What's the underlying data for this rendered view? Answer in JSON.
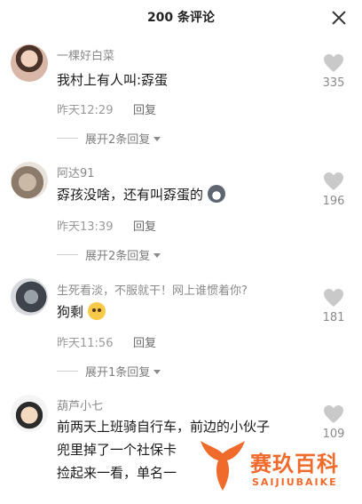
{
  "header": {
    "title": "200 条评论"
  },
  "comments": [
    {
      "username": "一棵好白菜",
      "lines": [
        "我村上有人叫:孬蛋"
      ],
      "time": "昨天12:29",
      "reply_label": "回复",
      "expand_label": "展开2条回复",
      "likes": "335"
    },
    {
      "username": "阿达91",
      "lines": [
        "孬孩没啥，还有叫孬蛋的"
      ],
      "time": "昨天13:39",
      "reply_label": "回复",
      "expand_label": "展开2条回复",
      "likes": "196"
    },
    {
      "username": "生死看淡，不服就干！网上谁惯着你?",
      "lines": [
        "狗剩"
      ],
      "time": "昨天11:56",
      "reply_label": "回复",
      "expand_label": "展开1条回复",
      "likes": "181"
    },
    {
      "username": "葫芦小七",
      "lines": [
        "前两天上班骑自行车，前边的小伙子",
        "兜里掉了一个社保卡",
        "捡起来一看，单名一"
      ],
      "likes": "109"
    }
  ],
  "watermark": {
    "cn": "赛玖百科",
    "en": "SAIJIUBAIKE"
  },
  "colors": {
    "accent": "#f06a2b",
    "muted_text": "#9a9a9a"
  }
}
